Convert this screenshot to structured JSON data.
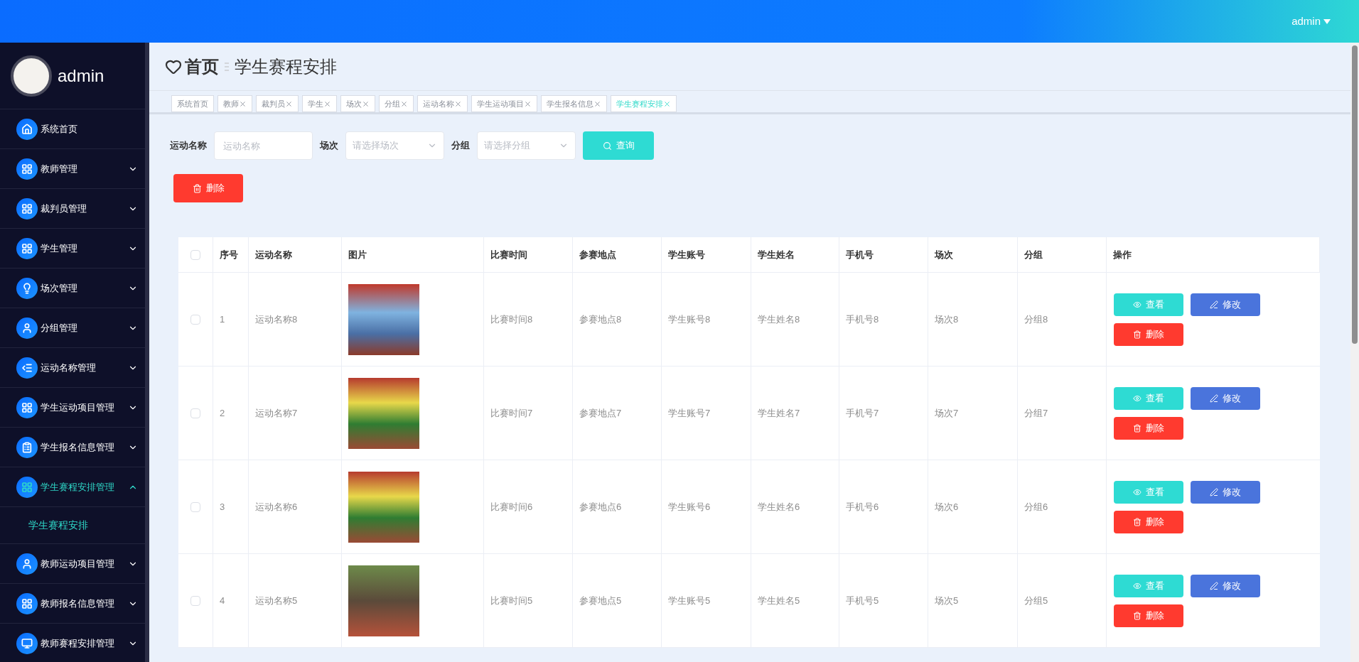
{
  "header": {
    "user": "admin"
  },
  "sidebar": {
    "user": "admin",
    "items": [
      {
        "label": "系统首页",
        "selected": false
      },
      {
        "label": "教师管理",
        "expanded": false,
        "selected": false
      },
      {
        "label": "裁判员管理",
        "expanded": false,
        "selected": false
      },
      {
        "label": "学生管理",
        "expanded": false,
        "selected": false
      },
      {
        "label": "场次管理",
        "expanded": false,
        "selected": false
      },
      {
        "label": "分组管理",
        "expanded": false,
        "selected": false
      },
      {
        "label": "运动名称管理",
        "expanded": false,
        "selected": false
      },
      {
        "label": "学生运动项目管理",
        "expanded": false,
        "selected": false
      },
      {
        "label": "学生报名信息管理",
        "expanded": false,
        "selected": false
      },
      {
        "label": "学生赛程安排管理",
        "expanded": true,
        "selected": true,
        "children": [
          {
            "label": "学生赛程安排",
            "selected": true
          }
        ]
      },
      {
        "label": "教师运动项目管理",
        "expanded": false,
        "selected": false
      },
      {
        "label": "教师报名信息管理",
        "expanded": false,
        "selected": false
      },
      {
        "label": "教师赛程安排管理",
        "expanded": false,
        "selected": false
      }
    ]
  },
  "breadcrumb": {
    "home": "首页",
    "current": "学生赛程安排"
  },
  "tabs": [
    {
      "label": "系统首页",
      "selected": false,
      "closable": false
    },
    {
      "label": "教师",
      "selected": false,
      "closable": true
    },
    {
      "label": "裁判员",
      "selected": false,
      "closable": true
    },
    {
      "label": "学生",
      "selected": false,
      "closable": true
    },
    {
      "label": "场次",
      "selected": false,
      "closable": true
    },
    {
      "label": "分组",
      "selected": false,
      "closable": true
    },
    {
      "label": "运动名称",
      "selected": false,
      "closable": true
    },
    {
      "label": "学生运动项目",
      "selected": false,
      "closable": true
    },
    {
      "label": "学生报名信息",
      "selected": false,
      "closable": true
    },
    {
      "label": "学生赛程安排",
      "selected": true,
      "closable": true
    }
  ],
  "search": {
    "fields": [
      {
        "kind": "input",
        "label": "运动名称",
        "placeholder": "运动名称"
      },
      {
        "kind": "select",
        "label": "场次",
        "placeholder": "请选择场次"
      },
      {
        "kind": "select",
        "label": "分组",
        "placeholder": "请选择分组"
      }
    ],
    "button": "查询"
  },
  "delete_button": "删除",
  "table": {
    "header_checked": false,
    "columns": [
      "序号",
      "运动名称",
      "图片",
      "比赛时间",
      "参赛地点",
      "学生账号",
      "学生姓名",
      "手机号",
      "场次",
      "分组",
      "操作"
    ],
    "rows": [
      {
        "checked": false,
        "cells": [
          "1",
          "运动名称8",
          "",
          "比赛时间8",
          "参赛地点8",
          "学生账号8",
          "学生姓名8",
          "手机号8",
          "场次8",
          "分组8"
        ],
        "actions": [
          {
            "kind": "view",
            "label": "查看"
          },
          {
            "kind": "edit",
            "label": "修改"
          },
          {
            "kind": "delete",
            "label": "删除"
          }
        ]
      },
      {
        "checked": false,
        "cells": [
          "2",
          "运动名称7",
          "",
          "比赛时间7",
          "参赛地点7",
          "学生账号7",
          "学生姓名7",
          "手机号7",
          "场次7",
          "分组7"
        ],
        "actions": [
          {
            "kind": "view",
            "label": "查看"
          },
          {
            "kind": "edit",
            "label": "修改"
          },
          {
            "kind": "delete",
            "label": "删除"
          }
        ]
      },
      {
        "checked": false,
        "cells": [
          "3",
          "运动名称6",
          "",
          "比赛时间6",
          "参赛地点6",
          "学生账号6",
          "学生姓名6",
          "手机号6",
          "场次6",
          "分组6"
        ],
        "actions": [
          {
            "kind": "view",
            "label": "查看"
          },
          {
            "kind": "edit",
            "label": "修改"
          },
          {
            "kind": "delete",
            "label": "删除"
          }
        ]
      },
      {
        "checked": false,
        "cells": [
          "4",
          "运动名称5",
          "",
          "比赛时间5",
          "参赛地点5",
          "学生账号5",
          "学生姓名5",
          "手机号5",
          "场次5",
          "分组5"
        ],
        "actions": [
          {
            "kind": "view",
            "label": "查看"
          },
          {
            "kind": "edit",
            "label": "修改"
          },
          {
            "kind": "delete",
            "label": "删除"
          }
        ]
      }
    ]
  }
}
